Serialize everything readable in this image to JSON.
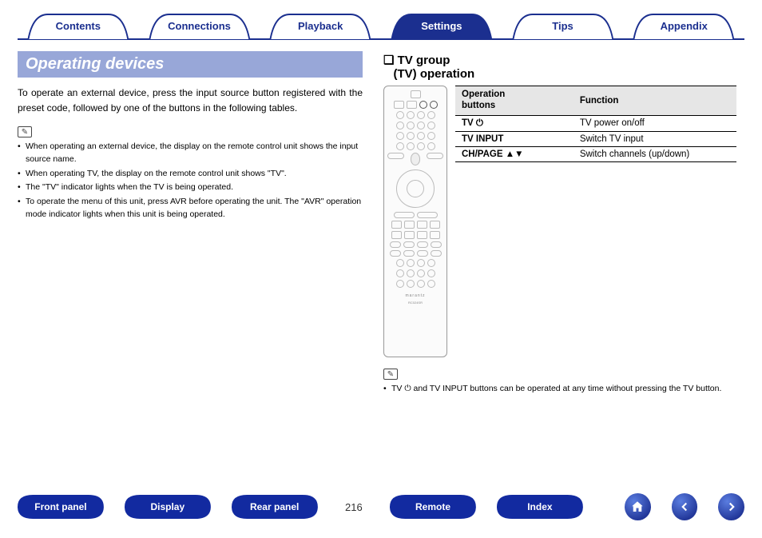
{
  "tabs": [
    {
      "id": "contents",
      "label": "Contents"
    },
    {
      "id": "connections",
      "label": "Connections"
    },
    {
      "id": "playback",
      "label": "Playback"
    },
    {
      "id": "settings",
      "label": "Settings"
    },
    {
      "id": "tips",
      "label": "Tips"
    },
    {
      "id": "appendix",
      "label": "Appendix"
    }
  ],
  "active_tab_id": "settings",
  "heading": "Operating devices",
  "intro": "To operate an external device, press the input source button registered with the preset code, followed by one of the buttons in the following tables.",
  "left_notes": [
    "When operating an external device, the display on the remote control unit shows the input source name.",
    "When operating TV, the display on the remote control unit shows \"TV\".",
    "The \"TV\" indicator lights when the TV is being operated.",
    "To operate the menu of this unit, press AVR before operating the unit. The \"AVR\" operation mode indicator lights when this unit is being operated."
  ],
  "sub_heading_line1": "TV group",
  "sub_heading_line2": "(TV) operation",
  "table": {
    "head": {
      "col1": "Operation buttons",
      "col2": "Function"
    },
    "rows": [
      {
        "btn": "TV ⏻",
        "fn": "TV power on/off"
      },
      {
        "btn": "TV INPUT",
        "fn": "Switch TV input"
      },
      {
        "btn": "CH/PAGE ▲▼",
        "fn": "Switch channels (up/down)"
      }
    ]
  },
  "right_note": "TV ⏻ and TV INPUT buttons can be operated at any time without pressing the TV button.",
  "remote_brand": "marantz",
  "remote_model": "RC024SR",
  "footer_buttons": [
    {
      "id": "front-panel",
      "label": "Front panel"
    },
    {
      "id": "display",
      "label": "Display"
    },
    {
      "id": "rear-panel",
      "label": "Rear panel"
    },
    {
      "id": "remote",
      "label": "Remote"
    },
    {
      "id": "index",
      "label": "Index"
    }
  ],
  "page_number": "216"
}
